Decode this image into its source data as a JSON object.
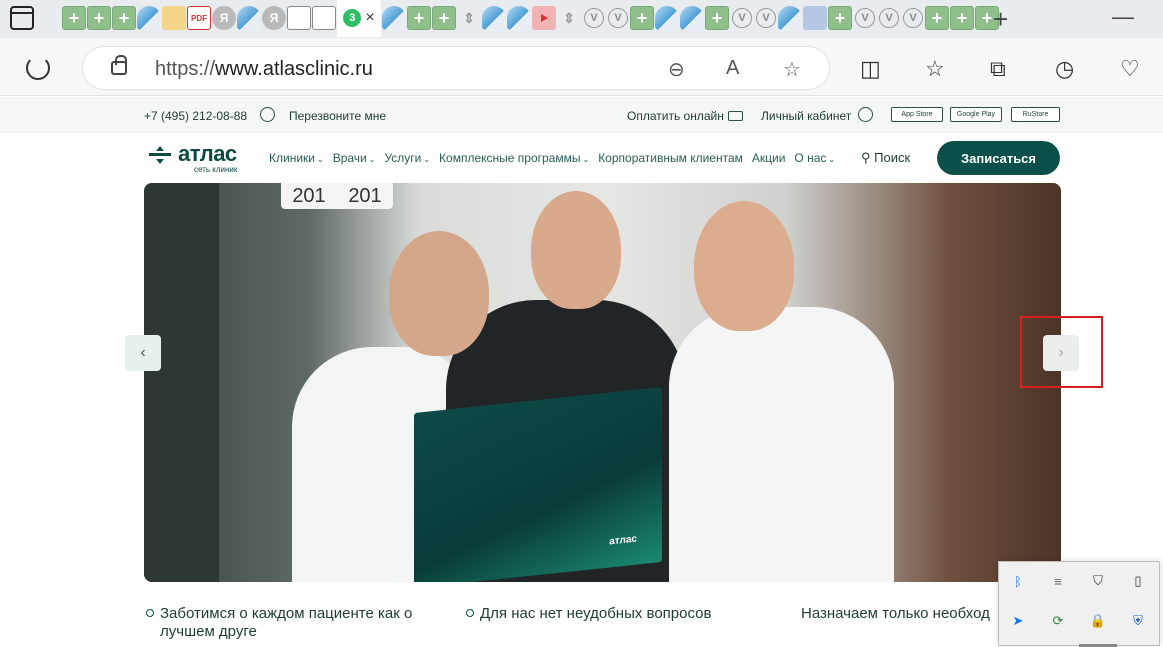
{
  "browser": {
    "tabs": [
      {
        "type": "green",
        "glyph": "+"
      },
      {
        "type": "green",
        "glyph": "+"
      },
      {
        "type": "green",
        "glyph": "+"
      },
      {
        "type": "edge",
        "glyph": ""
      },
      {
        "type": "mail",
        "glyph": ""
      },
      {
        "type": "pdf",
        "glyph": "PDF"
      },
      {
        "type": "ya",
        "glyph": "Я"
      },
      {
        "type": "edge",
        "glyph": ""
      },
      {
        "type": "ya",
        "glyph": "Я"
      },
      {
        "type": "doc",
        "glyph": ""
      },
      {
        "type": "doc",
        "glyph": ""
      }
    ],
    "active_tab_badge": "3",
    "active_tab_close": "×",
    "tabs_after": [
      {
        "type": "edge",
        "glyph": ""
      },
      {
        "type": "green",
        "glyph": "+"
      },
      {
        "type": "green",
        "glyph": "+"
      },
      {
        "type": "arrows",
        "glyph": "⇕"
      },
      {
        "type": "edge",
        "glyph": ""
      },
      {
        "type": "edge",
        "glyph": ""
      },
      {
        "type": "yt",
        "glyph": ""
      },
      {
        "type": "arrows",
        "glyph": "⇕"
      },
      {
        "type": "vv",
        "glyph": "V"
      },
      {
        "type": "vv",
        "glyph": "V"
      },
      {
        "type": "green",
        "glyph": "+"
      },
      {
        "type": "edge",
        "glyph": ""
      },
      {
        "type": "edge",
        "glyph": ""
      },
      {
        "type": "green",
        "glyph": "+"
      },
      {
        "type": "vv",
        "glyph": "V"
      },
      {
        "type": "vv",
        "glyph": "V"
      },
      {
        "type": "edge",
        "glyph": ""
      },
      {
        "type": "sq",
        "glyph": ""
      },
      {
        "type": "green",
        "glyph": "+"
      },
      {
        "type": "vv",
        "glyph": "V"
      },
      {
        "type": "vv",
        "glyph": "V"
      },
      {
        "type": "vv",
        "glyph": "V"
      },
      {
        "type": "green",
        "glyph": "+"
      },
      {
        "type": "green",
        "glyph": "+"
      },
      {
        "type": "green",
        "glyph": "+"
      }
    ],
    "new_tab": "+",
    "minimize": "—",
    "url_scheme": "https://",
    "url_host": "www.atlasclinic.ru"
  },
  "topbar": {
    "phone": "+7 (495) 212-08-88",
    "callback": "Перезвоните мне",
    "pay_online": "Оплатить онлайн",
    "account": "Личный кабинет",
    "app_store": "App Store",
    "google_play": "Google Play",
    "rustore": "RuStore"
  },
  "nav": {
    "logo_word": "атлас",
    "logo_sub": "сеть клиник",
    "items": [
      {
        "label": "Клиники",
        "caret": true
      },
      {
        "label": "Врачи",
        "caret": true
      },
      {
        "label": "Услуги",
        "caret": true
      },
      {
        "label": "Комплексные программы",
        "caret": true
      },
      {
        "label": "Корпоративным клиентам",
        "caret": false
      },
      {
        "label": "Акции",
        "caret": false
      },
      {
        "label": "О нас",
        "caret": true
      }
    ],
    "search_label": "Поиск",
    "cta_label": "Записаться"
  },
  "hero": {
    "door_sign_left": "201",
    "door_sign_right": "201",
    "folder_label": "атлас",
    "prev_arrow": "‹",
    "next_arrow": "›"
  },
  "features": [
    "Заботимся о каждом пациенте как о лучшем друге",
    "Для нас нет неудобных вопросов",
    "Назначаем только необход"
  ],
  "colors": {
    "brand": "#0b5048",
    "highlight": "#d81e1e"
  }
}
